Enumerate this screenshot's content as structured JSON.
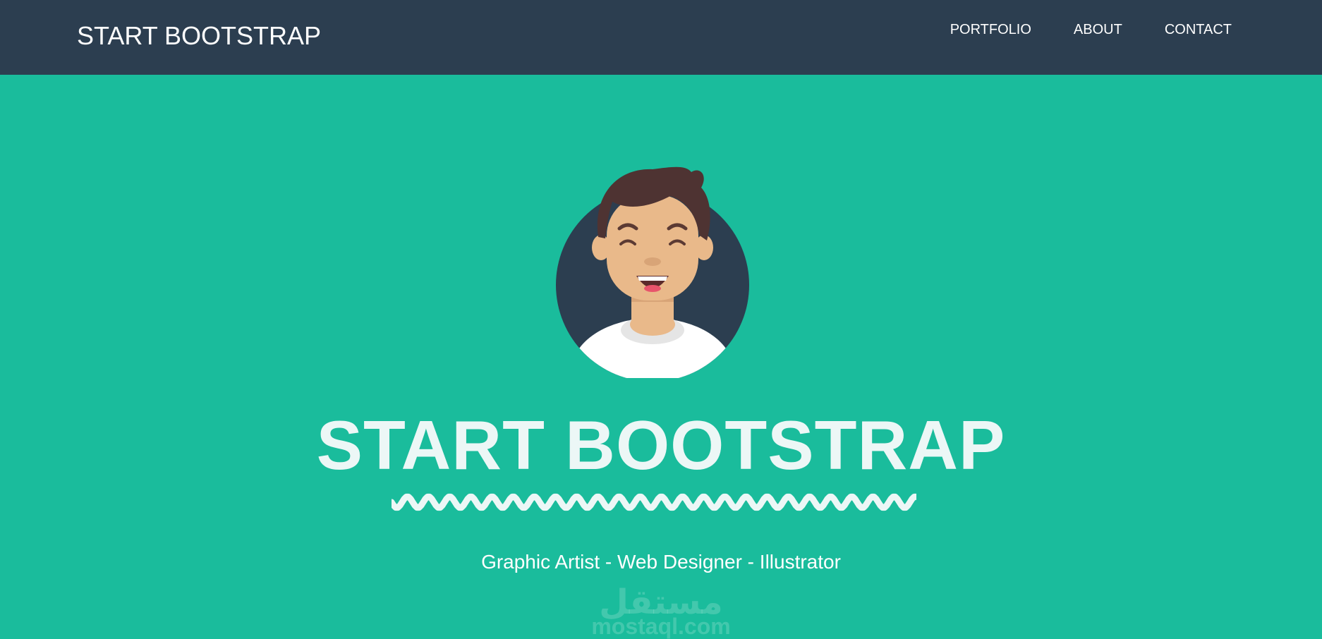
{
  "navbar": {
    "brand": "START BOOTSTRAP",
    "links": [
      {
        "label": "PORTFOLIO"
      },
      {
        "label": "ABOUT"
      },
      {
        "label": "CONTACT"
      }
    ],
    "background": "#2c3e50"
  },
  "hero": {
    "avatar_icon": "avatar-icon",
    "title": "START BOOTSTRAP",
    "divider_icon": "wavy-divider-icon",
    "subtitle": "Graphic Artist - Web Designer - Illustrator",
    "background": "#1abc9c"
  },
  "watermark": {
    "arabic": "مستقل",
    "url": "mostaql.com"
  }
}
